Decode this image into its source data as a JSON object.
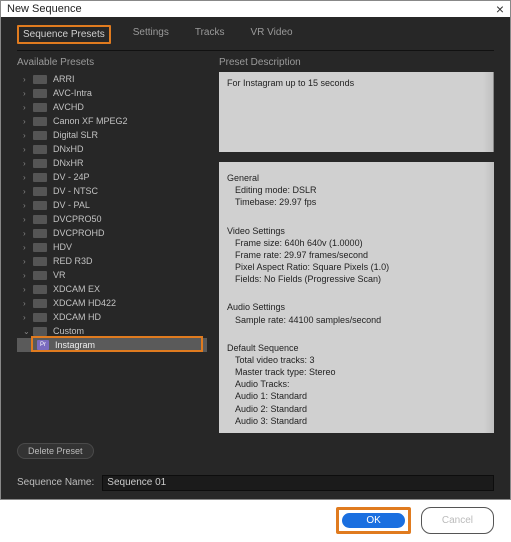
{
  "window": {
    "title": "New Sequence"
  },
  "tabs": {
    "items": [
      {
        "label": "Sequence Presets",
        "active": true
      },
      {
        "label": "Settings",
        "active": false
      },
      {
        "label": "Tracks",
        "active": false
      },
      {
        "label": "VR Video",
        "active": false
      }
    ]
  },
  "left": {
    "label": "Available Presets",
    "items": [
      {
        "label": "ARRI"
      },
      {
        "label": "AVC-Intra"
      },
      {
        "label": "AVCHD"
      },
      {
        "label": "Canon XF MPEG2"
      },
      {
        "label": "Digital SLR"
      },
      {
        "label": "DNxHD"
      },
      {
        "label": "DNxHR"
      },
      {
        "label": "DV - 24P"
      },
      {
        "label": "DV - NTSC"
      },
      {
        "label": "DV - PAL"
      },
      {
        "label": "DVCPRO50"
      },
      {
        "label": "DVCPROHD"
      },
      {
        "label": "HDV"
      },
      {
        "label": "RED R3D"
      },
      {
        "label": "VR"
      },
      {
        "label": "XDCAM EX"
      },
      {
        "label": "XDCAM HD422"
      },
      {
        "label": "XDCAM HD"
      },
      {
        "label": "Custom",
        "expanded": true
      }
    ],
    "selected_child": {
      "label": "Instagram"
    },
    "delete_label": "Delete Preset"
  },
  "right": {
    "desc_label": "Preset Description",
    "description": "For Instagram up to 15 seconds",
    "details": {
      "general_header": "General",
      "editing_mode": "Editing mode: DSLR",
      "timebase": "Timebase: 29.97 fps",
      "video_header": "Video Settings",
      "frame_size": "Frame size: 640h 640v (1.0000)",
      "frame_rate": "Frame rate: 29.97  frames/second",
      "pixel_aspect": "Pixel Aspect Ratio: Square Pixels (1.0)",
      "fields": "Fields: No Fields (Progressive Scan)",
      "audio_header": "Audio Settings",
      "sample_rate": "Sample rate: 44100 samples/second",
      "default_header": "Default Sequence",
      "total_video_tracks": "Total video tracks: 3",
      "master_track_type": "Master track type: Stereo",
      "audio_tracks_header": "Audio Tracks:",
      "audio1": "Audio 1: Standard",
      "audio2": "Audio 2: Standard",
      "audio3": "Audio 3: Standard"
    }
  },
  "sequence_name": {
    "label": "Sequence Name:",
    "value": "Sequence 01"
  },
  "footer": {
    "ok": "OK",
    "cancel": "Cancel"
  },
  "colors": {
    "highlight": "#e07b1f",
    "primary": "#1a6fe0"
  }
}
